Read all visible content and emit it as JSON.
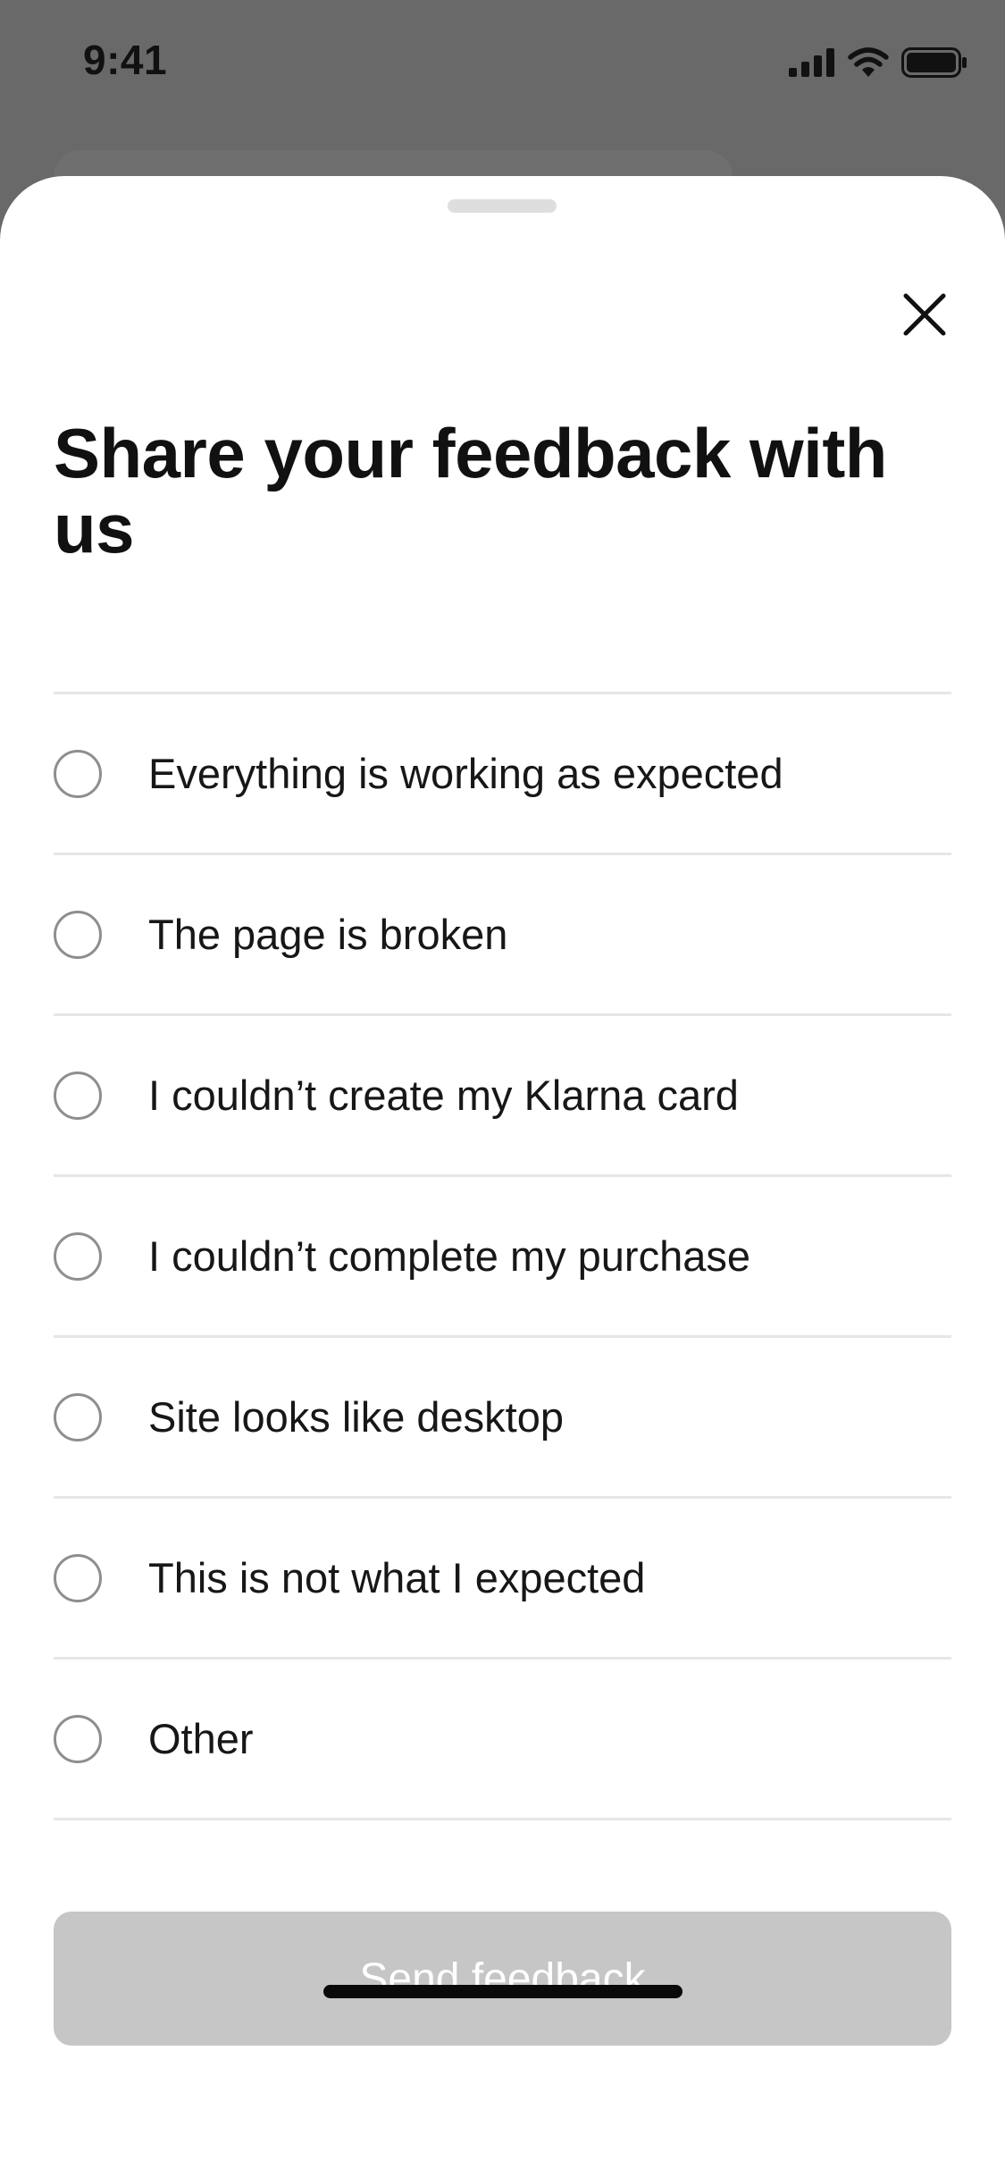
{
  "status_bar": {
    "time": "9:41",
    "icons": [
      "cellular-signal-icon",
      "wifi-icon",
      "battery-icon"
    ]
  },
  "sheet": {
    "title": "Share your feedback with us",
    "close_icon": "close-icon",
    "options": [
      {
        "label": "Everything is working as expected",
        "selected": false
      },
      {
        "label": "The page is broken",
        "selected": false
      },
      {
        "label": "I couldn’t create my Klarna card",
        "selected": false
      },
      {
        "label": "I couldn’t complete my purchase",
        "selected": false
      },
      {
        "label": "Site looks like desktop",
        "selected": false
      },
      {
        "label": "This is not what I expected",
        "selected": false
      },
      {
        "label": "Other",
        "selected": false
      }
    ],
    "send_button_label": "Send feedback",
    "send_button_enabled": false
  },
  "colors": {
    "backdrop": "#696969",
    "sheet_background": "#ffffff",
    "divider": "#e6e6e6",
    "radio_border": "#8e8e8e",
    "button_disabled": "#c6c6c6",
    "button_text": "#ffffff",
    "text_primary": "#111111"
  }
}
